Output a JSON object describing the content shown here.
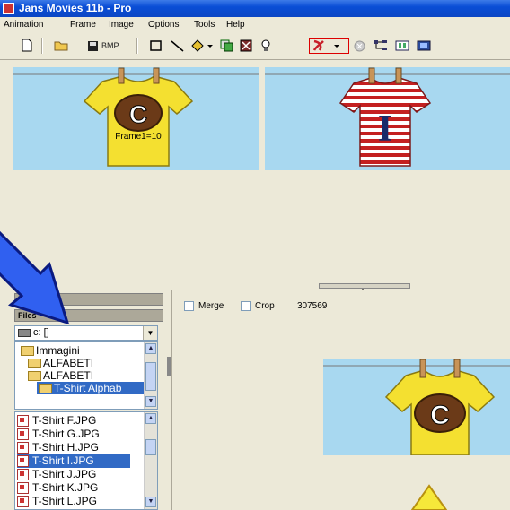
{
  "window": {
    "title": "Jans Movies 11b - Pro"
  },
  "menu": [
    "Animation",
    "Frame",
    "Image",
    "Options",
    "Tools",
    "Help"
  ],
  "toolbar": {
    "bmp_label": "BMP",
    "selected_tool": "animation-dropdown"
  },
  "frames": [
    {
      "letter": "C",
      "label": "Frame1=10",
      "shirt": "yellow"
    },
    {
      "letter": "I",
      "label": "",
      "shirt": "red-striped"
    }
  ],
  "left_panel": {
    "header_top": "Fra",
    "header_files": "Files",
    "drive": "c: []",
    "tree": [
      {
        "label": "Immagini",
        "selected": false
      },
      {
        "label": "ALFABETI",
        "selected": false
      },
      {
        "label": "ALFABETI",
        "selected": false
      },
      {
        "label": "T-Shirt Alphab",
        "selected": true
      }
    ],
    "files": [
      {
        "label": "T-Shirt F.JPG",
        "selected": false
      },
      {
        "label": "T-Shirt G.JPG",
        "selected": false
      },
      {
        "label": "T-Shirt H.JPG",
        "selected": false
      },
      {
        "label": "T-Shirt I.JPG",
        "selected": true
      },
      {
        "label": "T-Shirt J.JPG",
        "selected": false
      },
      {
        "label": "T-Shirt K.JPG",
        "selected": false
      },
      {
        "label": "T-Shirt L.JPG",
        "selected": false
      }
    ]
  },
  "right_panel": {
    "merge_label": "Merge",
    "crop_label": "Crop",
    "size_value": "307569",
    "preview": {
      "letter": "C",
      "shirt": "yellow"
    }
  },
  "colors": {
    "titlebar": "#0b46c4",
    "sky": "#a8d8f0",
    "selection": "#316ac5",
    "accent_red": "#d00000"
  }
}
